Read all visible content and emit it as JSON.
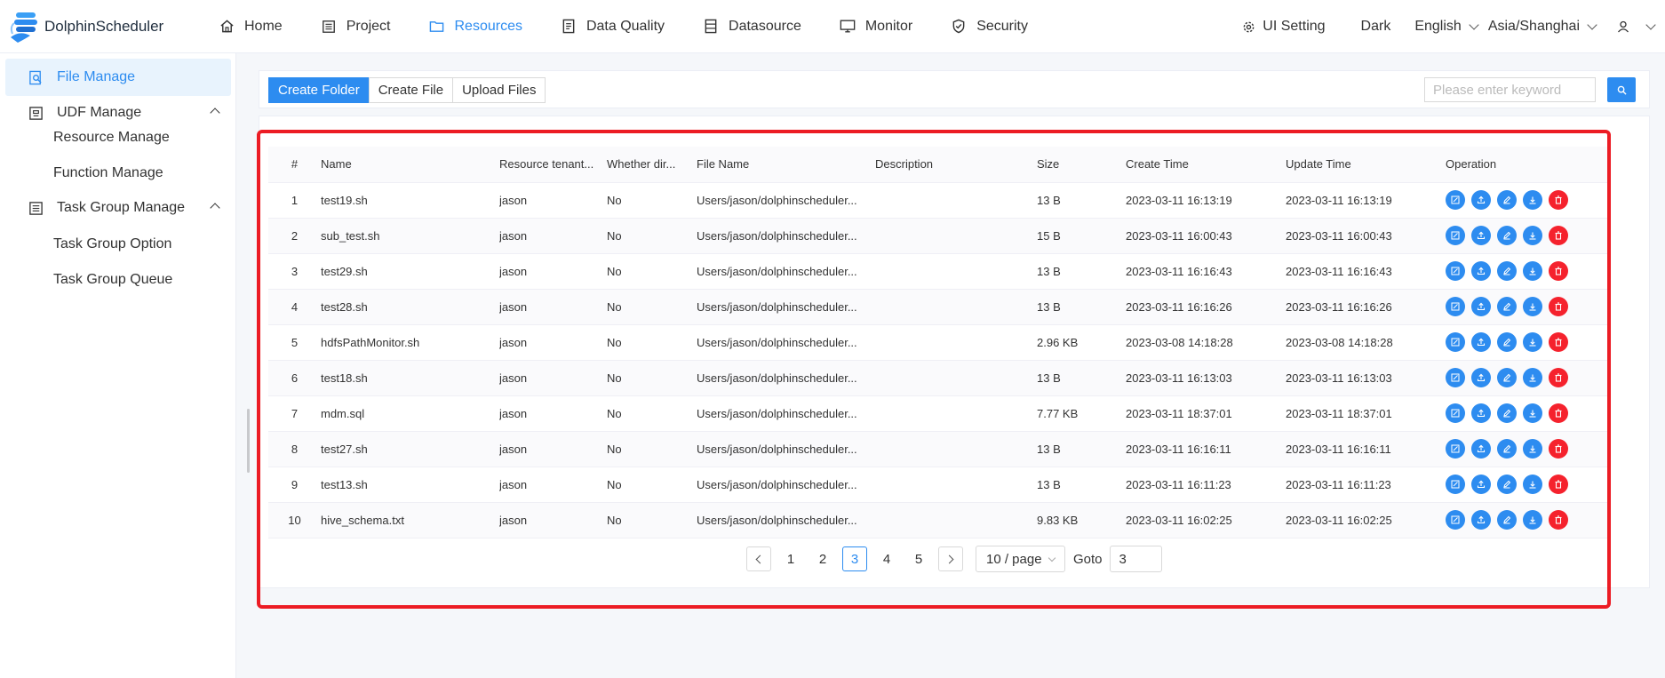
{
  "app": {
    "name": "DolphinScheduler"
  },
  "nav": [
    {
      "label": "Home",
      "icon": "home-icon",
      "active": false
    },
    {
      "label": "Project",
      "icon": "project-icon",
      "active": false
    },
    {
      "label": "Resources",
      "icon": "folder-icon",
      "active": true
    },
    {
      "label": "Data Quality",
      "icon": "data-quality-icon",
      "active": false
    },
    {
      "label": "Datasource",
      "icon": "datasource-icon",
      "active": false
    },
    {
      "label": "Monitor",
      "icon": "monitor-icon",
      "active": false
    },
    {
      "label": "Security",
      "icon": "shield-icon",
      "active": false
    }
  ],
  "tools": {
    "ui_setting": "UI Setting",
    "theme": "Dark",
    "language": "English",
    "timezone": "Asia/Shanghai"
  },
  "sidebar": {
    "file_manage": "File Manage",
    "udf_manage": "UDF Manage",
    "resource_manage": "Resource Manage",
    "function_manage": "Function Manage",
    "task_group_manage": "Task Group Manage",
    "task_group_option": "Task Group Option",
    "task_group_queue": "Task Group Queue"
  },
  "toolbar": {
    "create_folder": "Create Folder",
    "create_file": "Create File",
    "upload_files": "Upload Files",
    "search_placeholder": "Please enter keyword"
  },
  "table": {
    "headers": [
      "#",
      "Name",
      "Resource tenant...",
      "Whether dir...",
      "File Name",
      "Description",
      "Size",
      "Create Time",
      "Update Time",
      "Operation"
    ],
    "rows": [
      {
        "idx": "1",
        "name": "test19.sh",
        "tenant": "jason",
        "dir": "No",
        "file": "Users/jason/dolphinscheduler...",
        "desc": "",
        "size": "13 B",
        "created": "2023-03-11 16:13:19",
        "updated": "2023-03-11 16:13:19"
      },
      {
        "idx": "2",
        "name": "sub_test.sh",
        "tenant": "jason",
        "dir": "No",
        "file": "Users/jason/dolphinscheduler...",
        "desc": "",
        "size": "15 B",
        "created": "2023-03-11 16:00:43",
        "updated": "2023-03-11 16:00:43"
      },
      {
        "idx": "3",
        "name": "test29.sh",
        "tenant": "jason",
        "dir": "No",
        "file": "Users/jason/dolphinscheduler...",
        "desc": "",
        "size": "13 B",
        "created": "2023-03-11 16:16:43",
        "updated": "2023-03-11 16:16:43"
      },
      {
        "idx": "4",
        "name": "test28.sh",
        "tenant": "jason",
        "dir": "No",
        "file": "Users/jason/dolphinscheduler...",
        "desc": "",
        "size": "13 B",
        "created": "2023-03-11 16:16:26",
        "updated": "2023-03-11 16:16:26"
      },
      {
        "idx": "5",
        "name": "hdfsPathMonitor.sh",
        "tenant": "jason",
        "dir": "No",
        "file": "Users/jason/dolphinscheduler...",
        "desc": "",
        "size": "2.96 KB",
        "created": "2023-03-08 14:18:28",
        "updated": "2023-03-08 14:18:28"
      },
      {
        "idx": "6",
        "name": "test18.sh",
        "tenant": "jason",
        "dir": "No",
        "file": "Users/jason/dolphinscheduler...",
        "desc": "",
        "size": "13 B",
        "created": "2023-03-11 16:13:03",
        "updated": "2023-03-11 16:13:03"
      },
      {
        "idx": "7",
        "name": "mdm.sql",
        "tenant": "jason",
        "dir": "No",
        "file": "Users/jason/dolphinscheduler...",
        "desc": "",
        "size": "7.77 KB",
        "created": "2023-03-11 18:37:01",
        "updated": "2023-03-11 18:37:01"
      },
      {
        "idx": "8",
        "name": "test27.sh",
        "tenant": "jason",
        "dir": "No",
        "file": "Users/jason/dolphinscheduler...",
        "desc": "",
        "size": "13 B",
        "created": "2023-03-11 16:16:11",
        "updated": "2023-03-11 16:16:11"
      },
      {
        "idx": "9",
        "name": "test13.sh",
        "tenant": "jason",
        "dir": "No",
        "file": "Users/jason/dolphinscheduler...",
        "desc": "",
        "size": "13 B",
        "created": "2023-03-11 16:11:23",
        "updated": "2023-03-11 16:11:23"
      },
      {
        "idx": "10",
        "name": "hive_schema.txt",
        "tenant": "jason",
        "dir": "No",
        "file": "Users/jason/dolphinscheduler...",
        "desc": "",
        "size": "9.83 KB",
        "created": "2023-03-11 16:02:25",
        "updated": "2023-03-11 16:02:25"
      }
    ],
    "operations": [
      "edit-icon",
      "upload-icon",
      "rename-icon",
      "download-icon",
      "delete-icon"
    ]
  },
  "pagination": {
    "pages": [
      "1",
      "2",
      "3",
      "4",
      "5"
    ],
    "current": "3",
    "page_size": "10 / page",
    "goto_label": "Goto",
    "goto_value": "3"
  },
  "colors": {
    "primary": "#2d8cf0",
    "danger": "#f5222d",
    "highlight": "#ec1c24"
  }
}
